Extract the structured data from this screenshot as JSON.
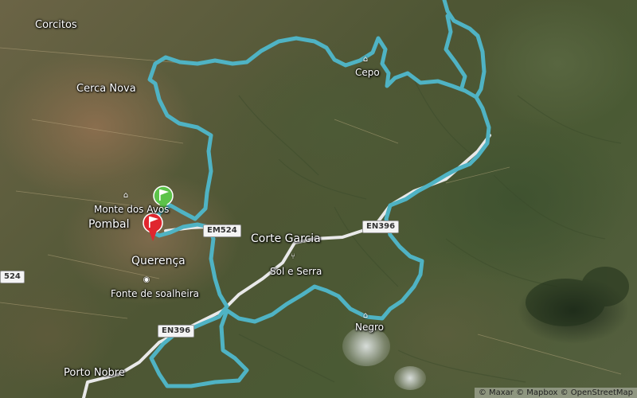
{
  "map": {
    "places": [
      {
        "name": "Corcitos",
        "size": "md"
      },
      {
        "name": "Cerca Nova",
        "size": "md"
      },
      {
        "name": "Monte dos Avos",
        "size": "sm"
      },
      {
        "name": "Pombal",
        "size": "lg"
      },
      {
        "name": "Querença",
        "size": "lg"
      },
      {
        "name": "Fonte de soalheira",
        "size": "sm"
      },
      {
        "name": "Corte Garcia",
        "size": "lg"
      },
      {
        "name": "Sol e Serra",
        "size": "sm"
      },
      {
        "name": "Cepo",
        "size": "sm"
      },
      {
        "name": "Negro",
        "size": "sm"
      },
      {
        "name": "Porto Nobre",
        "size": "md"
      }
    ],
    "road_shields": [
      "EM524",
      "EN396",
      "EN396",
      "524"
    ],
    "route_color": "#4fb3c4",
    "road_color": "#e9e9e9",
    "start_flag_color": "#5cc34a",
    "end_flag_color": "#e0262e",
    "attribution": "© Maxar © Mapbox © OpenStreetMap"
  }
}
